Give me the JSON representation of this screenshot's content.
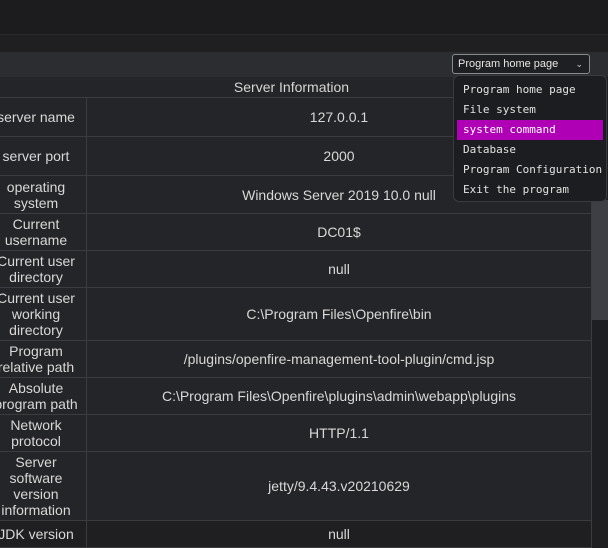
{
  "selector": {
    "value": "Program home page",
    "options": [
      "Program home page",
      "File system",
      "system command",
      "Database",
      "Program Configuration",
      "Exit the program"
    ],
    "highlighted_index": 2,
    "accent_color": "#b000b5"
  },
  "section_title": "Server Information",
  "rows": [
    {
      "key": "server name",
      "value": "127.0.0.1"
    },
    {
      "key": "server port",
      "value": "2000"
    },
    {
      "key": "operating system",
      "value": "Windows Server 2019 10.0 null"
    },
    {
      "key": "Current username",
      "value": "DC01$"
    },
    {
      "key": "Current user directory",
      "value": "null"
    },
    {
      "key": "Current user working directory",
      "value": "C:\\Program Files\\Openfire\\bin"
    },
    {
      "key": "Program relative path",
      "value": "/plugins/openfire-management-tool-plugin/cmd.jsp"
    },
    {
      "key": "Absolute program path",
      "value": "C:\\Program Files\\Openfire\\plugins\\admin\\webapp\\plugins"
    },
    {
      "key": "Network protocol",
      "value": "HTTP/1.1"
    },
    {
      "key": "Server software version information",
      "value": "jetty/9.4.43.v20210629"
    },
    {
      "key": "JDK version",
      "value": "null"
    }
  ]
}
